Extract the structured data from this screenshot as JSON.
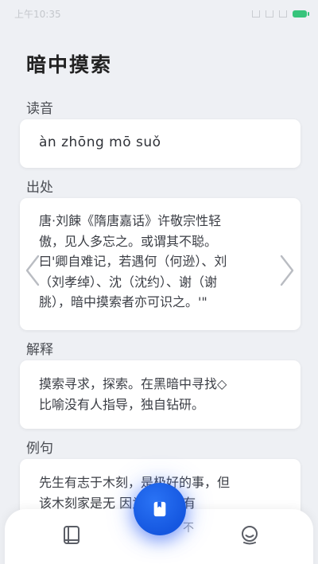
{
  "status_bar": {
    "time": "上午10:35"
  },
  "page": {
    "title": "暗中摸索"
  },
  "reading": {
    "label": "读音",
    "pinyin": "àn zhōng mō suǒ"
  },
  "source": {
    "label": "出处",
    "lines": [
      "唐·刘餗《隋唐嘉话》许敬宗性轻",
      "傲，见人多忘之。或谓其不聪。",
      "曰'卿自难记，若遇何（何逊）、刘",
      "（刘孝绰）、沈（沈约）、谢（谢",
      "朓），暗中摸索者亦可识之。'\""
    ]
  },
  "explanation": {
    "label": "解释",
    "lines": [
      "摸索寻求，探索。在黑暗中寻找◇",
      "比喻没有人指导，独自钻研。"
    ]
  },
  "example": {
    "label": "例句",
    "lines": [
      "先生有志于木刻，是极好的事，但",
      "该木刻家是无 因为就是已有"
    ],
    "obscured_fragment": "不"
  },
  "navigation": {
    "prev_icon": "chevron-left-icon",
    "next_icon": "chevron-right-icon",
    "tabs": [
      {
        "icon": "book-icon"
      },
      {
        "icon": "bookmark-icon"
      },
      {
        "icon": "profile-icon"
      }
    ]
  },
  "colors": {
    "background": "#eef0f4",
    "card": "#ffffff",
    "accent": "#1a5fe8",
    "battery": "#37c47b"
  }
}
